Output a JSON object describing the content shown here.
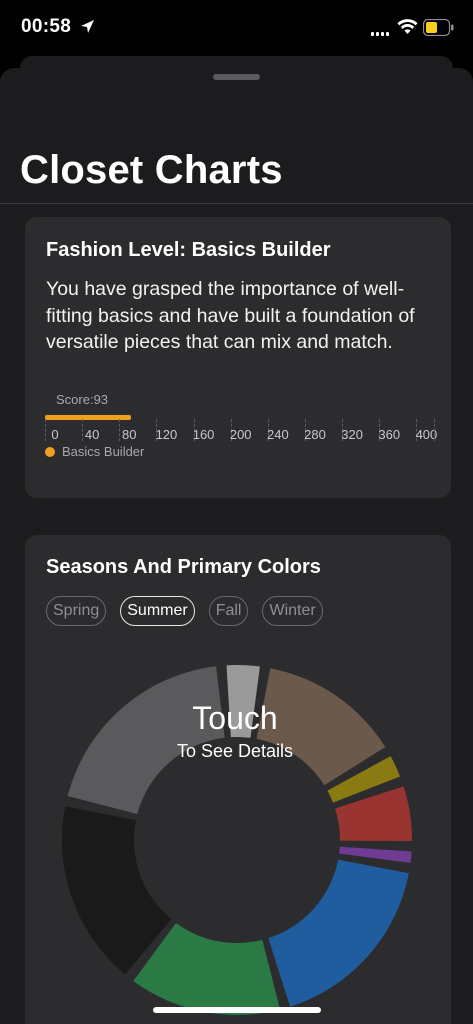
{
  "status_bar": {
    "time": "00:58",
    "icons": [
      "location-arrow-icon",
      "cellular-signal-icon",
      "wifi-icon",
      "battery-icon"
    ],
    "battery_color": "#f7ce1c"
  },
  "sheet": {
    "title": "Closet Charts"
  },
  "fashion_level": {
    "title": "Fashion Level: Basics Builder",
    "description": "You have grasped the importance of well-fitting basics and have built a foundation of versatile pieces that can mix and match.",
    "score_label": "Score:93",
    "legend": "Basics Builder",
    "chart_data": {
      "type": "bar",
      "orientation": "horizontal",
      "categories": [
        "Basics Builder"
      ],
      "values": [
        93
      ],
      "xlim": [
        0,
        420
      ],
      "ticks": [
        "0",
        "40",
        "80",
        "120",
        "160",
        "200",
        "240",
        "280",
        "320",
        "360",
        "400"
      ],
      "color": "#f0a020",
      "grid": "dashed",
      "legend_position": "bottom-left"
    }
  },
  "seasons": {
    "title": "Seasons And Primary Colors",
    "tabs": [
      {
        "label": "Spring",
        "active": false
      },
      {
        "label": "Summer",
        "active": true
      },
      {
        "label": "Fall",
        "active": false
      },
      {
        "label": "Winter",
        "active": false
      }
    ],
    "center_title": "Touch",
    "center_subtitle": "To See Details",
    "chart_data": {
      "type": "pie",
      "variant": "donut",
      "slices": [
        {
          "value": 4,
          "color": "#9a9a9a"
        },
        {
          "value": 14,
          "color": "#6b5a4b"
        },
        {
          "value": 3,
          "color": "#8a7a12"
        },
        {
          "value": 6,
          "color": "#9a3430"
        },
        {
          "value": 2,
          "color": "#6e3c93"
        },
        {
          "value": 18,
          "color": "#1f5d9e"
        },
        {
          "value": 15,
          "color": "#2b7a45"
        },
        {
          "value": 18,
          "color": "#1a1a1a"
        },
        {
          "value": 20,
          "color": "#5a5a5c"
        }
      ]
    }
  }
}
